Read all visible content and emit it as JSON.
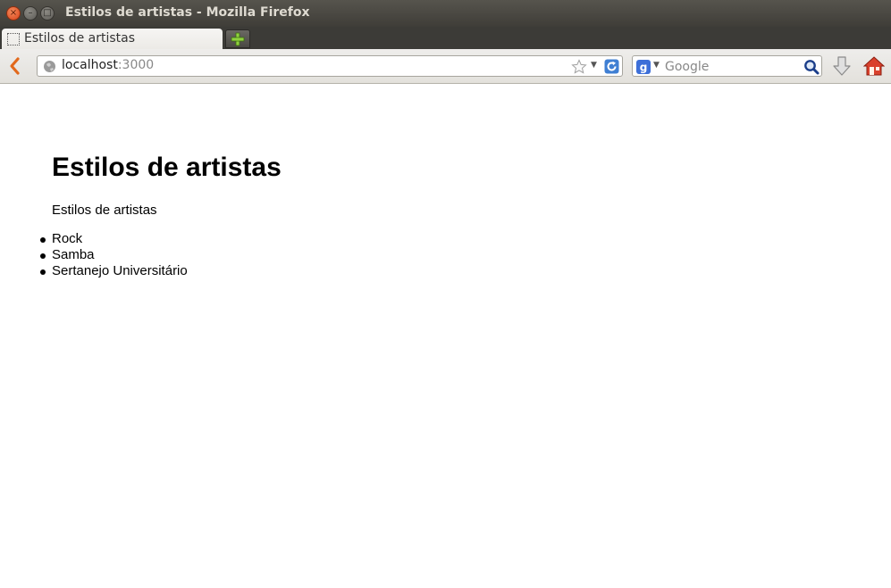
{
  "window": {
    "title": "Estilos de artistas - Mozilla Firefox",
    "close_icon": "close-icon",
    "minimize_icon": "minimize-icon",
    "maximize_icon": "maximize-icon"
  },
  "tabs": [
    {
      "label": "Estilos de artistas",
      "icon": "page-icon",
      "active": true
    }
  ],
  "new_tab_icon": "plus-icon",
  "navbar": {
    "back_icon": "back-arrow-icon",
    "url_host": "localhost",
    "url_port": ":3000",
    "url_icon": "globe-icon",
    "bookmark_icon": "star-icon",
    "history_dropdown_icon": "chevron-down-icon",
    "reload_icon": "reload-icon",
    "search_engine_icon": "google-icon",
    "search_placeholder": "Google",
    "search_go_icon": "search-icon",
    "downloads_icon": "download-arrow-icon",
    "home_icon": "home-icon"
  },
  "page": {
    "heading": "Estilos de artistas",
    "paragraph": "Estilos de artistas",
    "styles": [
      "Rock",
      "Samba",
      "Sertanejo Universitário"
    ]
  },
  "colors": {
    "titlebar": "#3f3d38",
    "tabstrip": "#3c3b37",
    "navbar": "#e3e1dc",
    "accent_reload": "#3f7fd3",
    "home": "#d9412c"
  }
}
